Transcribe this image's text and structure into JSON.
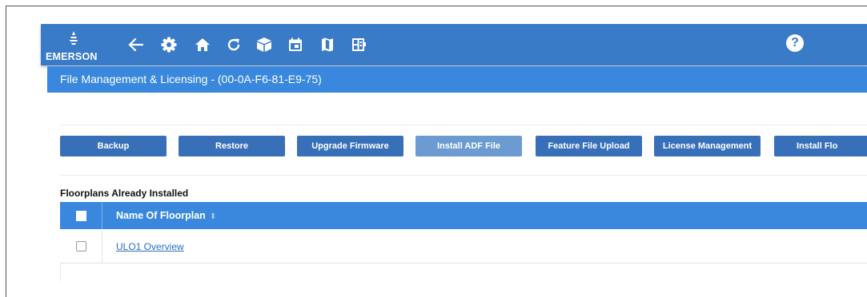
{
  "header": {
    "brand": "EMERSON",
    "nav_icons": [
      "back-arrow-icon",
      "gear-icon",
      "home-icon",
      "refresh-icon",
      "cube-icon",
      "calendar-icon",
      "map-icon",
      "dashboard-icon"
    ],
    "help_label": "?"
  },
  "subheader": {
    "title": "File Management & Licensing - (00-0A-F6-81-E9-75)"
  },
  "toolbar": {
    "buttons": [
      {
        "label": "Backup"
      },
      {
        "label": "Restore"
      },
      {
        "label": "Upgrade Firmware"
      },
      {
        "label": "Install ADF File",
        "disabled": true
      },
      {
        "label": "Feature File Upload"
      },
      {
        "label": "License Management"
      },
      {
        "label": "Install Flo"
      }
    ]
  },
  "floorplans": {
    "section_title": "Floorplans Already Installed",
    "column_header": "Name Of Floorplan",
    "sort_icon": "sort-icon",
    "rows": [
      {
        "name": "ULO1 Overview"
      }
    ]
  },
  "colors": {
    "topbar": "#3a7bc8",
    "subbar": "#3a88dd",
    "button": "#3770b8",
    "button_disabled": "#6c9bd2",
    "link": "#2a6ec5"
  }
}
